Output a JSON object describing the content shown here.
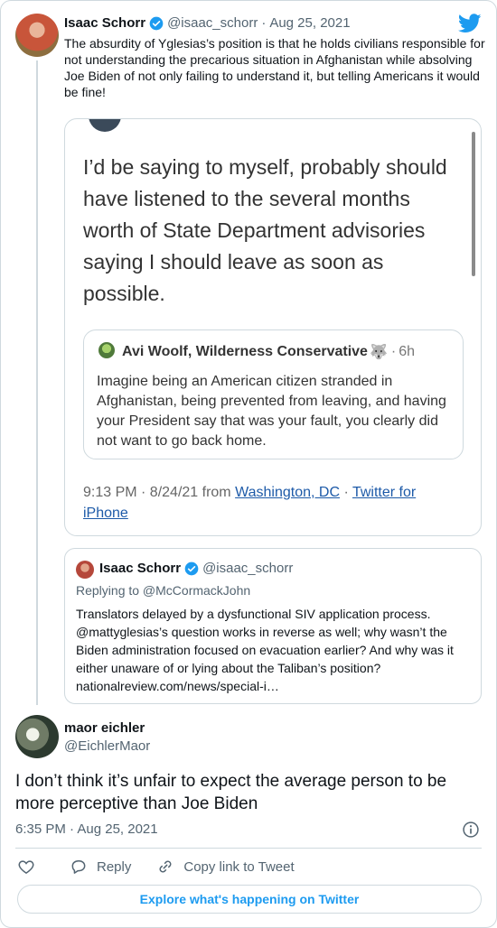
{
  "tweet": {
    "name": "Isaac Schorr",
    "handle": "@isaac_schorr",
    "separator": "·",
    "date": "Aug 25, 2021",
    "text": "The absurdity of Yglesias’s position is that he holds civilians responsible for not understanding the precarious situation in Afghanistan while absolving Joe Biden of not only failing to understand it, but telling Americans it would be fine!"
  },
  "screenshot": {
    "main_text": "I’d be saying to myself, probably should have listened to the several months worth of State Department advisories saying I should leave as soon as possible.",
    "inner_name": "Avi Woolf, Wilderness Conservative",
    "inner_emoji": "🐺",
    "inner_separator": "·",
    "inner_time": "6h",
    "inner_text": "Imagine being an American citizen stranded in Afghanistan, being prevented from leaving, and having your President say that was your fault, you clearly did not want to go back home.",
    "meta_time": "9:13 PM · 8/24/21 from",
    "meta_location": "Washington, DC",
    "meta_sep": "·",
    "meta_client": "Twitter for iPhone"
  },
  "quote": {
    "name": "Isaac Schorr",
    "handle": "@isaac_schorr",
    "replying_to": "Replying to @McCormackJohn",
    "text": "Translators delayed by a dysfunctional SIV application process. @mattyglesias’s question works in reverse as well; why wasn’t the Biden administration focused on evacuation earlier? And why was it either unaware of or lying about the Taliban’s position? nationalreview.com/news/special-i…"
  },
  "reply": {
    "name": "maor eichler",
    "handle": "@EichlerMaor",
    "text": "I don’t think it’s unfair to expect the average person to be more perceptive than Joe Biden",
    "timestamp": "6:35 PM · Aug 25, 2021"
  },
  "actions": {
    "reply_label": "Reply",
    "copy_label": "Copy link to Tweet"
  },
  "explore_label": "Explore what's happening on Twitter",
  "colors": {
    "accent": "#1d9bf0",
    "text": "#0f1419",
    "secondary": "#536471",
    "border": "#cfd9de"
  },
  "icons": [
    "verified-badge-icon",
    "twitter-bird-icon",
    "info-icon",
    "heart-icon",
    "reply-bubble-icon",
    "link-icon"
  ]
}
